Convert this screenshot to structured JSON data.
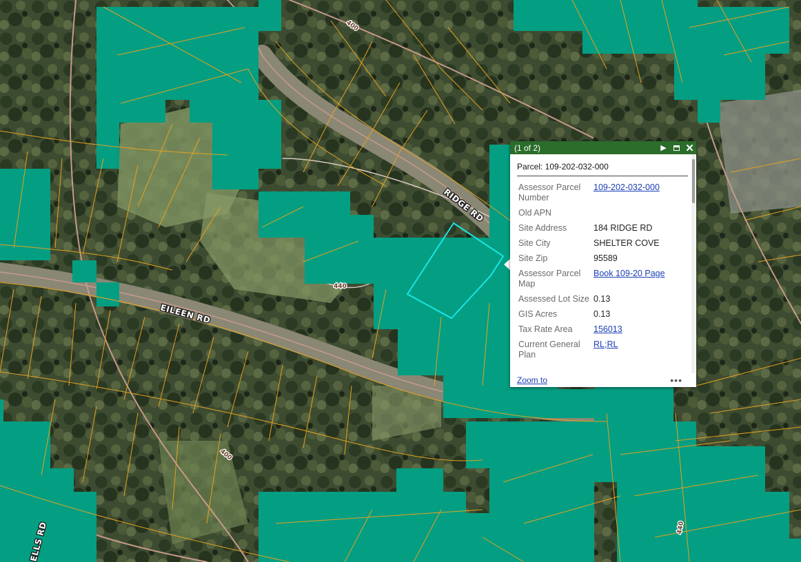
{
  "map": {
    "road_labels": [
      "RIDGE RD",
      "EILEEN RD",
      "ELLS RD"
    ],
    "route_shields": [
      "400",
      "400",
      "440",
      "440"
    ],
    "colors": {
      "zone_fill": "#049e82",
      "parcel_line": "#e5a21f",
      "selected_parcel": "#17e6e6",
      "road_outline": "#c79a8a"
    }
  },
  "popup": {
    "counter": "(1 of 2)",
    "next_icon": "play-icon",
    "maximize_icon": "maximize-icon",
    "close_icon": "close-icon",
    "title": "Parcel: 109-202-032-000",
    "attributes": [
      {
        "label": "Assessor Parcel Number",
        "value": "109-202-032-000",
        "link": true
      },
      {
        "label": "Old APN",
        "value": "",
        "link": false
      },
      {
        "label": "Site Address",
        "value": "184 RIDGE RD",
        "link": false
      },
      {
        "label": "Site City",
        "value": "SHELTER COVE",
        "link": false
      },
      {
        "label": "Site Zip",
        "value": "95589",
        "link": false
      },
      {
        "label": "Assessor Parcel Map",
        "value": "Book 109-20 Page",
        "link": true
      },
      {
        "label": "Assessed Lot Size",
        "value": "0.13",
        "link": false
      },
      {
        "label": "GIS Acres",
        "value": "0.13",
        "link": false
      },
      {
        "label": "Tax Rate Area",
        "value": "156013",
        "link": true
      },
      {
        "label": "Current General Plan",
        "value": "RL;RL",
        "link": true
      }
    ],
    "footer": {
      "zoom_to": "Zoom to",
      "more": "•••"
    }
  }
}
